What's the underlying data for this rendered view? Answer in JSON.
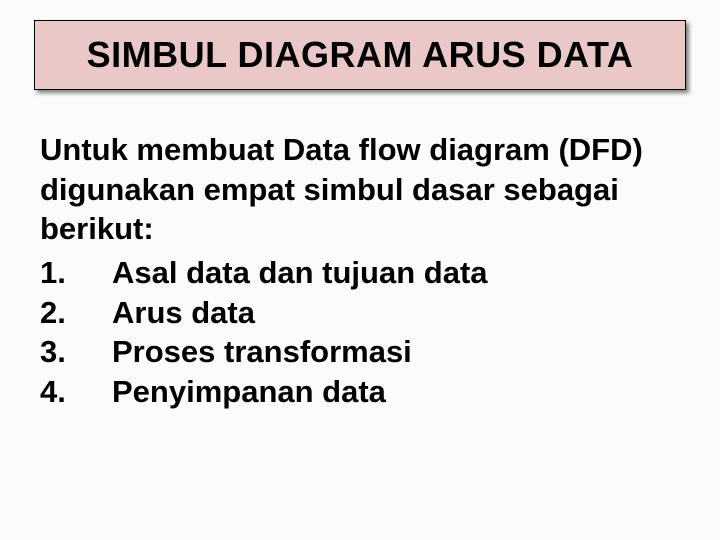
{
  "slide": {
    "title": "SIMBUL DIAGRAM ARUS DATA",
    "intro": "Untuk membuat Data flow diagram (DFD) digunakan empat simbul dasar sebagai berikut:",
    "items": [
      {
        "num": "1.",
        "label": "Asal data dan tujuan data"
      },
      {
        "num": "2.",
        "label": "Arus data"
      },
      {
        "num": "3.",
        "label": "Proses transformasi"
      },
      {
        "num": "4.",
        "label": "Penyimpanan data"
      }
    ]
  }
}
